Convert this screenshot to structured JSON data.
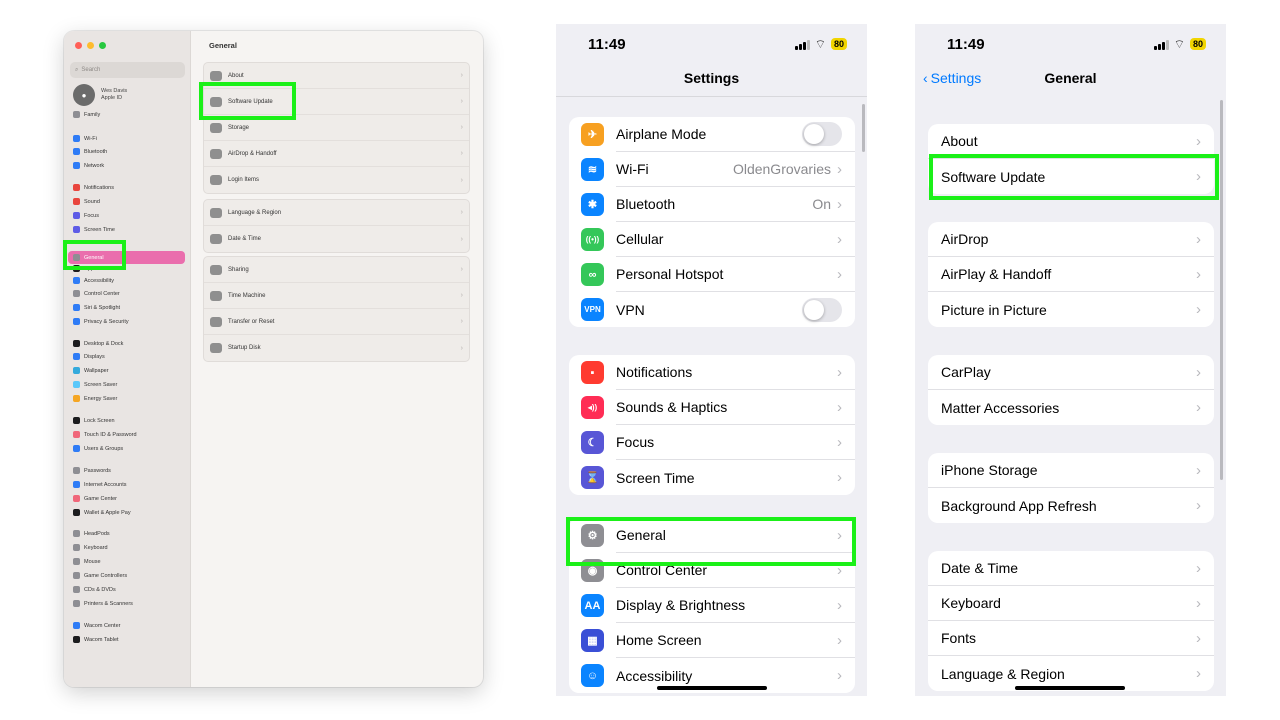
{
  "mac": {
    "sidebar": {
      "search_placeholder": "Search",
      "profile_name": "Wes Davis",
      "profile_sub": "Apple ID",
      "items": [
        {
          "label": "Family",
          "color": "#8e8e93"
        },
        {
          "label": "Wi-Fi",
          "color": "#2f7cf6"
        },
        {
          "label": "Bluetooth",
          "color": "#2f7cf6"
        },
        {
          "label": "Network",
          "color": "#2f7cf6"
        },
        {
          "label": "Notifications",
          "color": "#e9453d"
        },
        {
          "label": "Sound",
          "color": "#e9453d"
        },
        {
          "label": "Focus",
          "color": "#5e5ce6"
        },
        {
          "label": "Screen Time",
          "color": "#5e5ce6"
        },
        {
          "label": "General",
          "color": "#8e8e93"
        },
        {
          "label": "Appearance",
          "color": "#1c1c1e"
        },
        {
          "label": "Accessibility",
          "color": "#2f7cf6"
        },
        {
          "label": "Control Center",
          "color": "#8e8e93"
        },
        {
          "label": "Siri & Spotlight",
          "color": "#2f7cf6"
        },
        {
          "label": "Privacy & Security",
          "color": "#2f7cf6"
        },
        {
          "label": "Desktop & Dock",
          "color": "#1c1c1e"
        },
        {
          "label": "Displays",
          "color": "#2f7cf6"
        },
        {
          "label": "Wallpaper",
          "color": "#34aadc"
        },
        {
          "label": "Screen Saver",
          "color": "#5ac8fa"
        },
        {
          "label": "Energy Saver",
          "color": "#f5a623"
        },
        {
          "label": "Lock Screen",
          "color": "#1c1c1e"
        },
        {
          "label": "Touch ID & Password",
          "color": "#f0677a"
        },
        {
          "label": "Users & Groups",
          "color": "#2f7cf6"
        },
        {
          "label": "Passwords",
          "color": "#8e8e93"
        },
        {
          "label": "Internet Accounts",
          "color": "#2f7cf6"
        },
        {
          "label": "Game Center",
          "color": "#f0677a"
        },
        {
          "label": "Wallet & Apple Pay",
          "color": "#1c1c1e"
        },
        {
          "label": "HeadPods",
          "color": "#8e8e93"
        },
        {
          "label": "Keyboard",
          "color": "#8e8e93"
        },
        {
          "label": "Mouse",
          "color": "#8e8e93"
        },
        {
          "label": "Game Controllers",
          "color": "#8e8e93"
        },
        {
          "label": "CDs & DVDs",
          "color": "#8e8e93"
        },
        {
          "label": "Printers & Scanners",
          "color": "#8e8e93"
        },
        {
          "label": "Wacom Center",
          "color": "#2f7cf6"
        },
        {
          "label": "Wacom Tablet",
          "color": "#1c1c1e"
        }
      ]
    },
    "content": {
      "title": "General",
      "groups": [
        [
          {
            "label": "About",
            "icon": "info-icon"
          },
          {
            "label": "Software Update",
            "icon": "gear-icon"
          },
          {
            "label": "Storage",
            "icon": "drive-icon"
          },
          {
            "label": "AirDrop & Handoff",
            "icon": "airdrop-icon"
          },
          {
            "label": "Login Items",
            "icon": "list-icon"
          }
        ],
        [
          {
            "label": "Language & Region",
            "icon": "globe-icon"
          },
          {
            "label": "Date & Time",
            "icon": "calendar-icon"
          }
        ],
        [
          {
            "label": "Sharing",
            "icon": "sharing-icon"
          },
          {
            "label": "Time Machine",
            "icon": "clock-icon"
          },
          {
            "label": "Transfer or Reset",
            "icon": "reset-icon"
          },
          {
            "label": "Startup Disk",
            "icon": "disk-icon"
          }
        ]
      ]
    }
  },
  "phone1": {
    "time": "11:49",
    "battery": "80",
    "title": "Settings",
    "groups": [
      [
        {
          "label": "Airplane Mode",
          "icon": "airplane-icon",
          "glyph": "✈",
          "color": "#f7a021",
          "toggle": true
        },
        {
          "label": "Wi-Fi",
          "icon": "wifi-icon",
          "glyph": "≋",
          "color": "#0a84ff",
          "value": "OldenGrovaries"
        },
        {
          "label": "Bluetooth",
          "icon": "bluetooth-icon",
          "glyph": "✱",
          "color": "#0a84ff",
          "value": "On"
        },
        {
          "label": "Cellular",
          "icon": "cellular-icon",
          "glyph": "((•))",
          "color": "#34c759"
        },
        {
          "label": "Personal Hotspot",
          "icon": "hotspot-icon",
          "glyph": "∞",
          "color": "#34c759"
        },
        {
          "label": "VPN",
          "icon": "vpn-icon",
          "glyph": "VPN",
          "color": "#0a84ff",
          "toggle": true
        }
      ],
      [
        {
          "label": "Notifications",
          "icon": "notifications-icon",
          "glyph": "▪",
          "color": "#ff3b30"
        },
        {
          "label": "Sounds & Haptics",
          "icon": "sound-icon",
          "glyph": "◂))",
          "color": "#ff2d55"
        },
        {
          "label": "Focus",
          "icon": "moon-icon",
          "glyph": "☾",
          "color": "#5856d6"
        },
        {
          "label": "Screen Time",
          "icon": "hourglass-icon",
          "glyph": "⌛",
          "color": "#5856d6"
        }
      ],
      [
        {
          "label": "General",
          "icon": "gear-icon",
          "glyph": "⚙",
          "color": "#8e8e93"
        },
        {
          "label": "Control Center",
          "icon": "switches-icon",
          "glyph": "◉",
          "color": "#8e8e93"
        },
        {
          "label": "Display & Brightness",
          "icon": "display-icon",
          "glyph": "AA",
          "color": "#0a84ff"
        },
        {
          "label": "Home Screen",
          "icon": "home-screen-icon",
          "glyph": "▦",
          "color": "#3a4fd6"
        },
        {
          "label": "Accessibility",
          "icon": "accessibility-icon",
          "glyph": "☺",
          "color": "#0a84ff"
        }
      ]
    ]
  },
  "phone2": {
    "time": "11:49",
    "battery": "80",
    "back_label": "Settings",
    "title": "General",
    "groups": [
      [
        "About",
        "Software Update"
      ],
      [
        "AirDrop",
        "AirPlay & Handoff",
        "Picture in Picture"
      ],
      [
        "CarPlay",
        "Matter Accessories"
      ],
      [
        "iPhone Storage",
        "Background App Refresh"
      ],
      [
        "Date & Time",
        "Keyboard",
        "Fonts",
        "Language & Region"
      ]
    ]
  },
  "colors": {
    "highlight": "#1bf018",
    "ios_blue": "#007aff",
    "mac_selected": "#ea6ead"
  }
}
